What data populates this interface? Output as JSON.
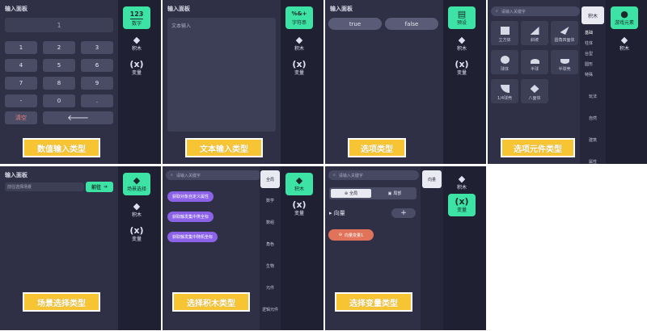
{
  "colors": {
    "accent": "#3ce3a4",
    "banner": "#f7c434",
    "panel": "#2f3045",
    "sidebar": "#1f2032",
    "purple": "#8c63e8",
    "orange": "#e0735a"
  },
  "sidebar": {
    "block": "积木",
    "variable": "变量"
  },
  "p1": {
    "title": "输入面板",
    "display": "1",
    "keys": [
      "1",
      "2",
      "3",
      "4",
      "5",
      "6",
      "7",
      "8",
      "9",
      "-",
      "0",
      "."
    ],
    "clear": "清空",
    "backspace": "🡐",
    "side_number": "数字",
    "side_number_icon": "123",
    "banner": "数值输入类型"
  },
  "p2": {
    "title": "输入面板",
    "placeholder": "文本输入",
    "side_string": "字符串",
    "side_string_icon": "%&+",
    "banner": "文本输入类型"
  },
  "p3": {
    "title": "输入面板",
    "true_label": "true",
    "false_label": "false",
    "side_preset": "预设",
    "banner": "选项类型"
  },
  "p4": {
    "search": "请输入关键字",
    "tab_block": "积木",
    "side_element": "游戏元素",
    "items": [
      "立方体",
      "斜坡",
      "圆角四面体",
      "球体",
      "半球",
      "半球壳",
      "1/4球壳",
      "八面体"
    ],
    "subcats": [
      "基础",
      "柱体",
      "台型",
      "圆形",
      "特殊"
    ],
    "cats": [
      "玩法",
      "自然",
      "建筑",
      "属性"
    ],
    "banner": "选项元件类型"
  },
  "p5": {
    "title": "输入面板",
    "input": "前往选择场景",
    "go": "前往",
    "side_scene": "场景选择",
    "banner": "场景选择类型"
  },
  "p6": {
    "search": "请输入关键字",
    "items": [
      "获取对象自定义属性",
      "获取触发集中类全标",
      "获取触发集中随机坐标"
    ],
    "cats": [
      "全局",
      "数学",
      "数组",
      "角色",
      "生物",
      "元件",
      "逻辑元件"
    ],
    "banner": "选择积木类型"
  },
  "p7": {
    "search": "请输入关键字",
    "tab_global": "全局",
    "tab_local": "局部",
    "section": "向量",
    "add": "+",
    "var_item": "向量变量1",
    "side_block": "向量",
    "banner": "选择变量类型"
  }
}
